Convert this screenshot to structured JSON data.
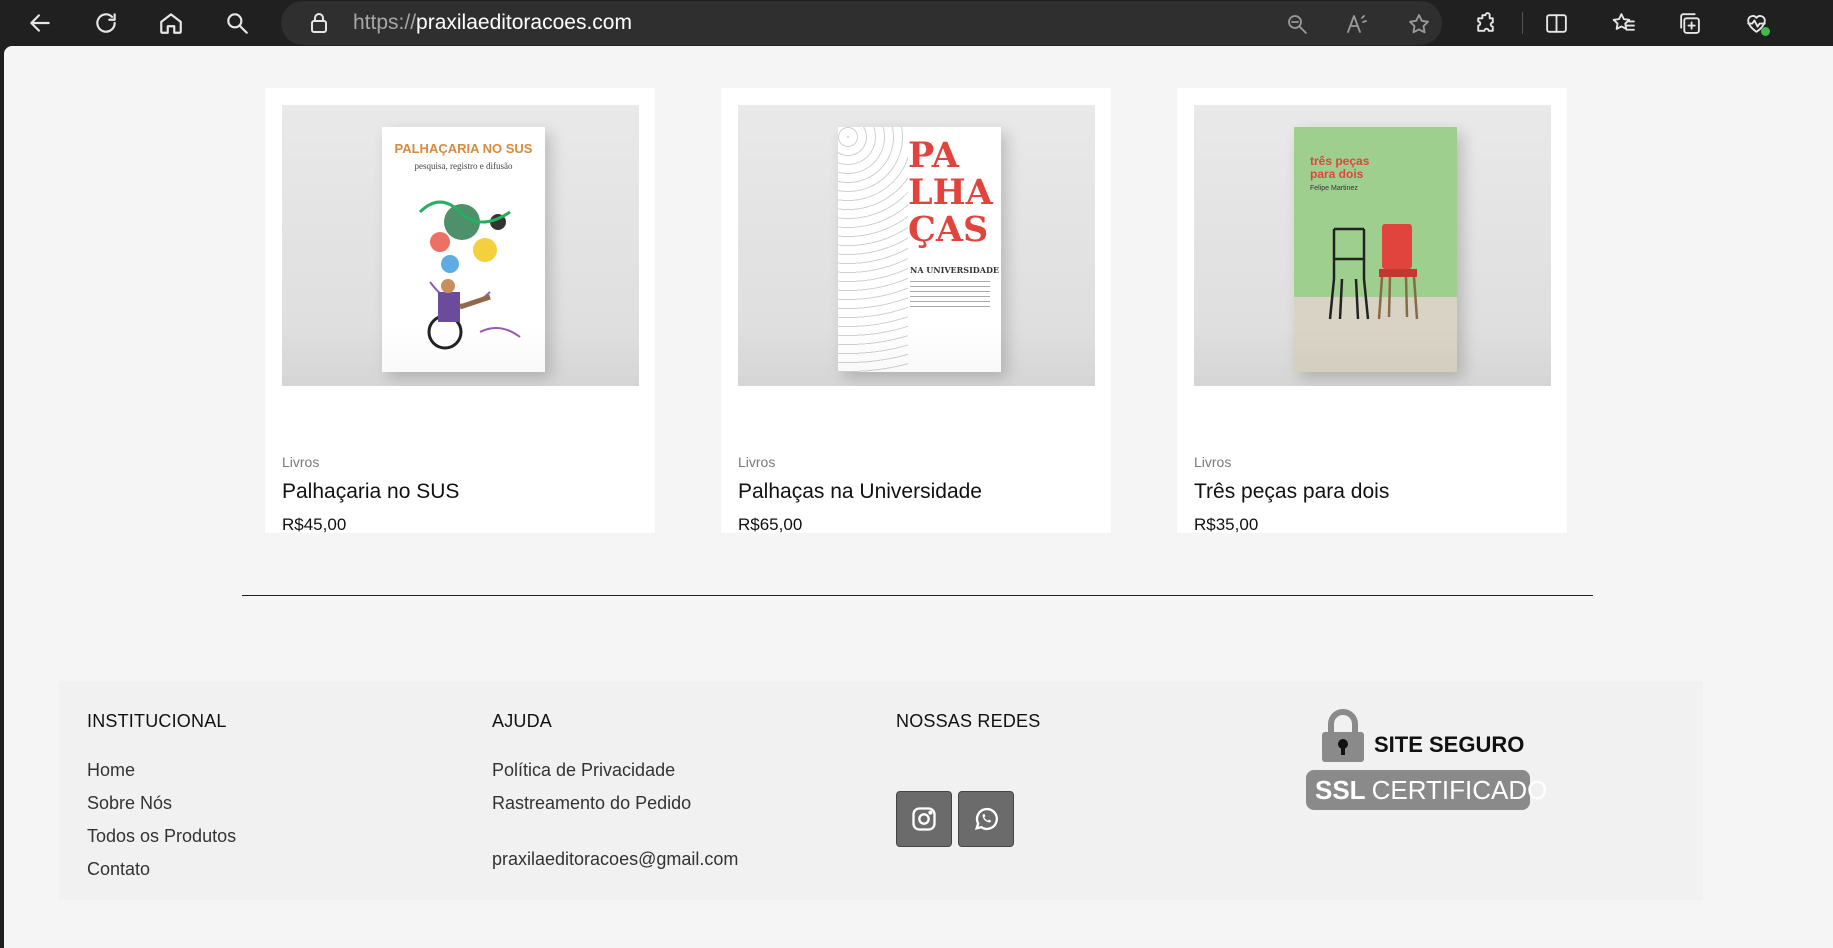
{
  "browser": {
    "url_protocol": "https://",
    "url_host": "praxilaeditoracoes.com",
    "icons": [
      "back-arrow-icon",
      "refresh-icon",
      "home-icon",
      "search-icon",
      "lock-icon",
      "zoom-out-icon",
      "read-aloud-icon",
      "favorite-star-icon",
      "extensions-icon",
      "split-screen-icon",
      "favorites-icon",
      "collections-icon",
      "browser-essentials-icon"
    ]
  },
  "products": [
    {
      "category": "Livros",
      "title": "Palhaçaria no SUS",
      "price": "R$45,00",
      "cover_title": "PALHAÇARIA NO SUS",
      "cover_subtitle": "pesquisa, registro e difusão",
      "cover_color": "#ffffff",
      "accent": "#d98a3c"
    },
    {
      "category": "Livros",
      "title": "Palhaças na Universidade",
      "price": "R$65,00",
      "cover_title": "PA LHA ÇAS",
      "cover_subtitle": "NA UNIVERSIDADE",
      "cover_color": "#ffffff",
      "accent": "#e0443c"
    },
    {
      "category": "Livros",
      "title": "Três peças para dois",
      "price": "R$35,00",
      "cover_title": "três peças para dois",
      "cover_subtitle": "Felipe Martinez",
      "cover_color": "#9fcf8e",
      "accent": "#e0443c"
    }
  ],
  "footer": {
    "institucional": {
      "heading": "INSTITUCIONAL",
      "links": [
        "Home",
        "Sobre Nós",
        "Todos os Produtos",
        "Contato"
      ]
    },
    "ajuda": {
      "heading": "AJUDA",
      "links": [
        "Política de Privacidade",
        "Rastreamento do Pedido"
      ],
      "email": "praxilaeditoracoes@gmail.com"
    },
    "redes": {
      "heading": "NOSSAS REDES",
      "icons": [
        "instagram-icon",
        "whatsapp-icon"
      ]
    },
    "ssl": {
      "top": "SITE SEGURO",
      "bottom_bold": "SSL",
      "bottom_rest": "CERTIFICADO"
    }
  }
}
